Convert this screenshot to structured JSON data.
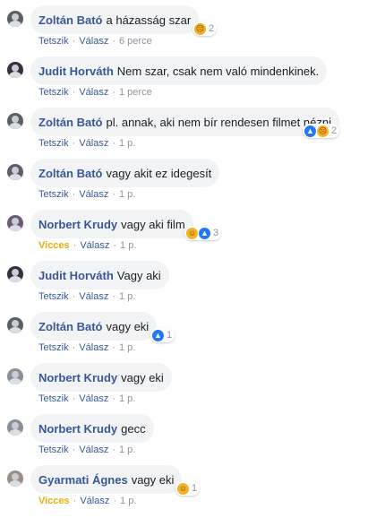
{
  "comments": [
    {
      "author": "Zoltán Bató",
      "text": "a házasság szar",
      "reactions": [
        "sad"
      ],
      "reaction_count": "2",
      "like_label": "Tetszik",
      "reply_label": "Válasz",
      "time": "6 perce"
    },
    {
      "author": "Judit Horváth",
      "text": "Nem szar, csak nem való mindenkinek.",
      "reactions": [],
      "reaction_count": "",
      "like_label": "Tetszik",
      "reply_label": "Válasz",
      "time": "1 perce"
    },
    {
      "author": "Zoltán Bató",
      "text": "pl. annak, aki nem bír rendesen filmet nézni",
      "reactions": [
        "like",
        "sad"
      ],
      "reaction_count": "2",
      "like_label": "Tetszik",
      "reply_label": "Válasz",
      "time": "1 p."
    },
    {
      "author": "Zoltán Bató",
      "text": "vagy akit ez idegesít",
      "reactions": [],
      "reaction_count": "",
      "like_label": "Tetszik",
      "reply_label": "Válasz",
      "time": "1 p."
    },
    {
      "author": "Norbert Krudy",
      "text": "vagy aki film",
      "reactions": [
        "haha",
        "like"
      ],
      "reaction_count": "3",
      "like_label": "Vicces",
      "reply_label": "Válasz",
      "time": "1 p."
    },
    {
      "author": "Judit Horváth",
      "text": "Vagy aki",
      "reactions": [],
      "reaction_count": "",
      "like_label": "Tetszik",
      "reply_label": "Válasz",
      "time": "1 p."
    },
    {
      "author": "Zoltán Bató",
      "text": "vagy eki",
      "reactions": [
        "like"
      ],
      "reaction_count": "1",
      "like_label": "Tetszik",
      "reply_label": "Válasz",
      "time": "1 p."
    },
    {
      "author": "Norbert Krudy",
      "text": "vagy eki",
      "reactions": [],
      "reaction_count": "",
      "like_label": "Tetszik",
      "reply_label": "Válasz",
      "time": "1 p."
    },
    {
      "author": "Norbert Krudy",
      "text": "gecc",
      "reactions": [],
      "reaction_count": "",
      "like_label": "Tetszik",
      "reply_label": "Válasz",
      "time": "1 p."
    },
    {
      "author": "Gyarmati Ágnes",
      "text": "vagy eki",
      "reactions": [
        "haha"
      ],
      "reaction_count": "1",
      "like_label": "Vicces",
      "reply_label": "Válasz",
      "time": "1 p."
    }
  ],
  "colors": {
    "author": "#385898",
    "bubble": "#f2f3f5",
    "meta": "#90949c",
    "vicces": "#e9b00a",
    "like": "#2078f4",
    "emoji_yellow": "#f7b125"
  }
}
